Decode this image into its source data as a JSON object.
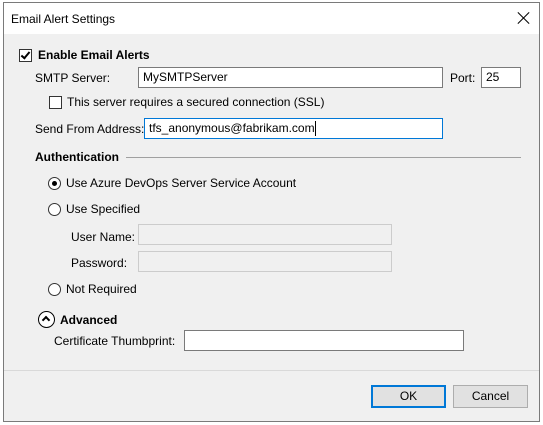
{
  "window": {
    "title": "Email Alert Settings"
  },
  "enable": {
    "label": "Enable Email Alerts",
    "checked": true
  },
  "smtp": {
    "server_label": "SMTP Server:",
    "server_value": "MySMTPServer",
    "port_label": "Port:",
    "port_value": "25",
    "ssl_label": "This server requires a secured connection (SSL)",
    "ssl_checked": false,
    "from_label": "Send From Address:",
    "from_value": "tfs_anonymous@fabrikam.com"
  },
  "authentication": {
    "heading": "Authentication",
    "option_service": "Use Azure DevOps Server Service Account",
    "option_specified": "Use Specified",
    "username_label": "User Name:",
    "username_value": "",
    "password_label": "Password:",
    "password_value": "",
    "option_not_required": "Not Required",
    "selected": "service"
  },
  "advanced": {
    "label": "Advanced",
    "thumbprint_label": "Certificate Thumbprint:",
    "thumbprint_value": ""
  },
  "footer": {
    "ok_label": "OK",
    "cancel_label": "Cancel"
  }
}
